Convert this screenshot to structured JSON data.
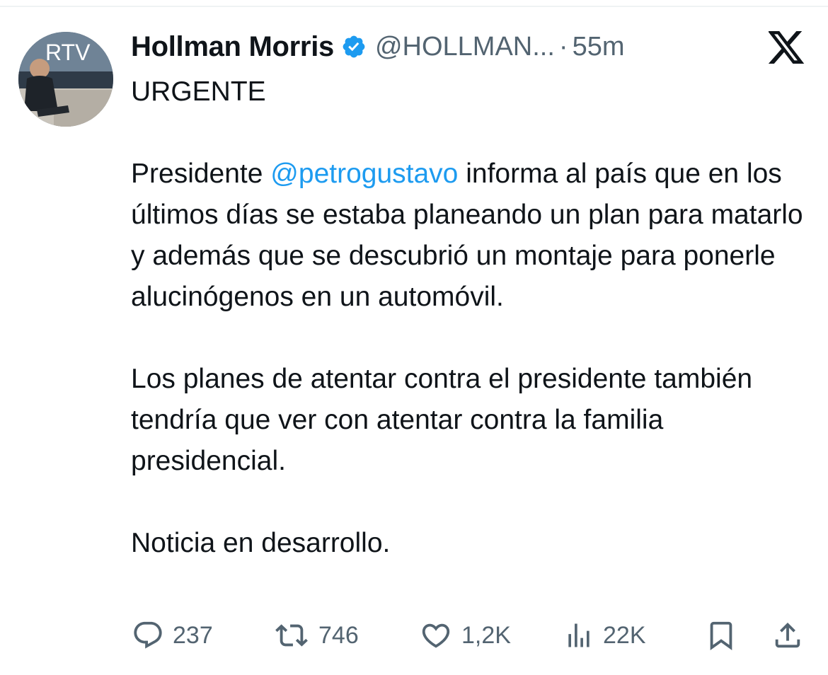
{
  "tweet": {
    "author": {
      "display_name": "Hollman Morris",
      "handle": "@HOLLMAN...",
      "verified": true,
      "avatar_text": "RTV"
    },
    "separator": "·",
    "time": "55m",
    "body": {
      "p1": "URGENTE",
      "p2_before": "Presidente ",
      "p2_mention": "@petrogustavo",
      "p2_after": " informa al país que en los últimos días se estaba planeando un plan para matarlo y además que se descubrió un montaje para ponerle alucinógenos en un automóvil.",
      "p3": "Los planes de atentar contra el presidente también tendría que ver con atentar contra la familia presidencial.",
      "p4": "Noticia en desarrollo."
    },
    "metrics": {
      "replies": "237",
      "reposts": "746",
      "likes": "1,2K",
      "views": "22K"
    }
  },
  "colors": {
    "text": "#0f1419",
    "secondary": "#536471",
    "link": "#1d9bf0",
    "verified": "#1d9bf0"
  },
  "icons": {
    "brand": "x-logo-icon",
    "verified": "verified-badge-icon",
    "reply": "reply-icon",
    "repost": "repost-icon",
    "like": "heart-icon",
    "views": "views-icon",
    "bookmark": "bookmark-icon",
    "share": "share-icon"
  }
}
